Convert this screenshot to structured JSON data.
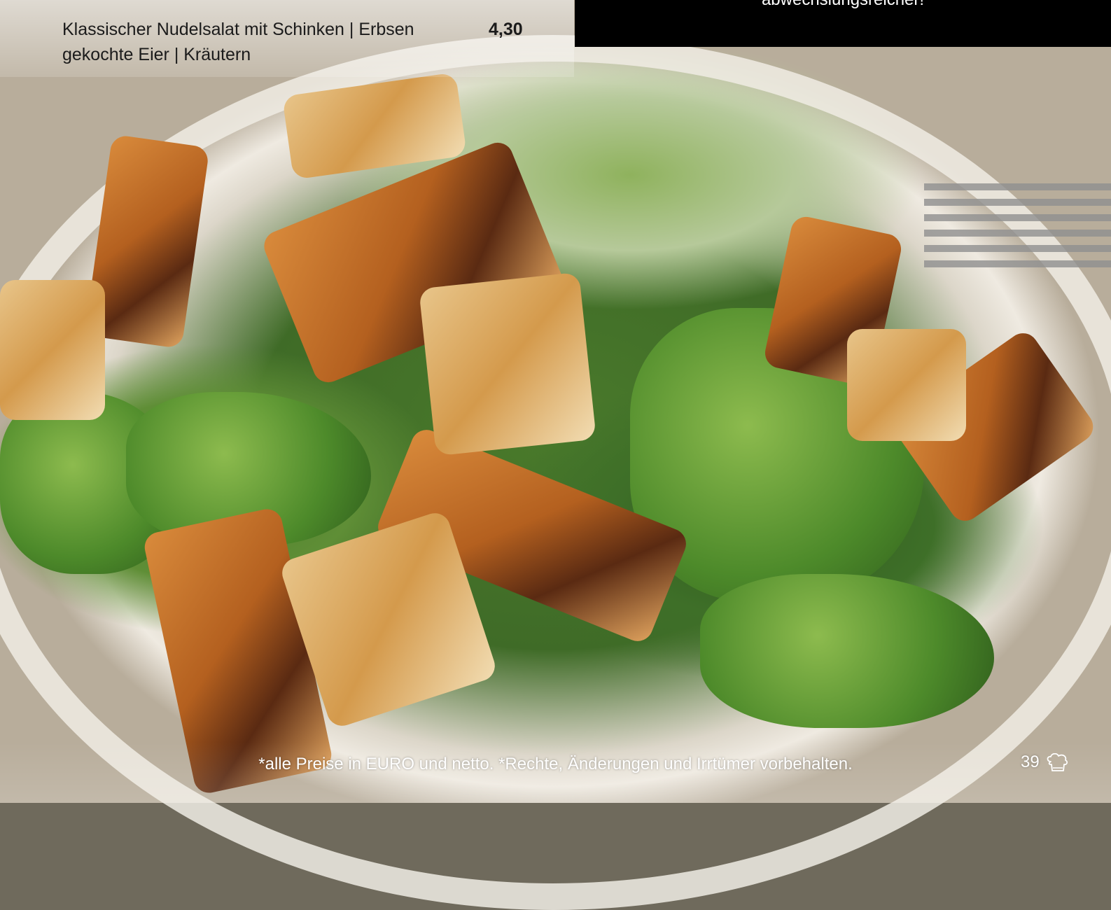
{
  "menu": {
    "item_line1": "Klassischer Nudelsalat mit Schinken | Erbsen",
    "item_line2": "gekochte Eier | Kräutern",
    "price": "4,30"
  },
  "header_box": {
    "text": "abwechslungsreicher!"
  },
  "footer": {
    "note": "*alle Preise in EURO und netto. *Rechte, Änderungen und Irrtümer vorbehalten.",
    "page_number": "39",
    "icon": "chef-hat-icon"
  }
}
